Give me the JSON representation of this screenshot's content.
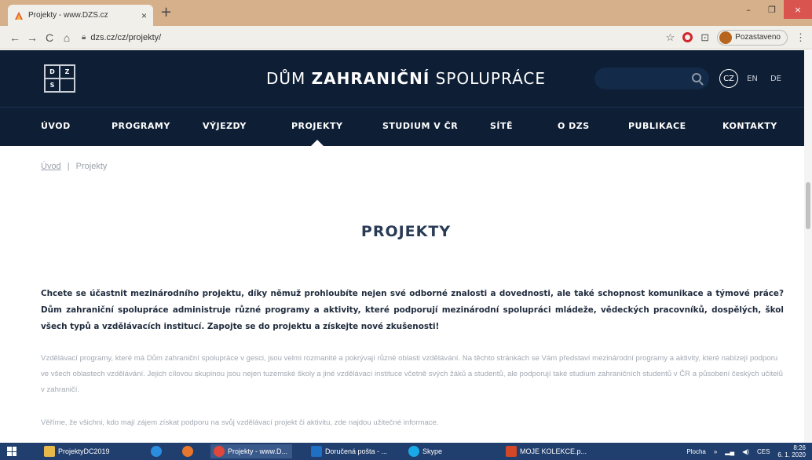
{
  "browser": {
    "tab_title": "Projekty - www.DZS.cz",
    "tab_close": "×",
    "new_tab": "+",
    "url": "dzs.cz/cz/projekty/",
    "profile_label": "Pozastaveno",
    "win_minimize": "–",
    "win_restore": "❐",
    "win_close": "×"
  },
  "site": {
    "logo": [
      "D",
      "Z",
      "S",
      ""
    ],
    "title_pre": "DŮM ",
    "title_bold": "ZAHRANIČNÍ",
    "title_post": " SPOLUPRÁCE",
    "search_placeholder": "",
    "langs": [
      "CZ",
      "EN",
      "DE"
    ],
    "active_lang": "CZ"
  },
  "nav": {
    "items": [
      "ÚVOD",
      "PROGRAMY",
      "VÝJEZDY",
      "PROJEKTY",
      "STUDIUM V ČR",
      "SÍTĚ",
      "O DZS",
      "PUBLIKACE",
      "KONTAKTY"
    ],
    "active": "PROJEKTY"
  },
  "breadcrumb": {
    "home": "Úvod",
    "separator": "|",
    "current": "Projekty"
  },
  "page": {
    "title": "PROJEKTY",
    "lead": "Chcete se účastnit mezinárodního projektu, díky němuž prohloubíte nejen své odborné znalosti a dovednosti, ale také schopnost komunikace a týmové práce? Dům zahraniční spolupráce administruje různé programy a aktivity, které podporují mezinárodní spolupráci mládeže, vědeckých pracovníků, dospělých, škol všech typů a vzdělávacích institucí. Zapojte se do projektu a získejte nové zkušenosti!",
    "p1": "Vzdělávací programy, které má Dům zahraniční spolupráce v gesci, jsou velmi rozmanité a pokrývají různé oblasti vzdělávání. Na těchto stránkách se Vám představí mezinárodní programy a aktivity, které nabízejí podporu ve všech oblastech vzdělávání. Jejich cílovou skupinou jsou nejen tuzemské školy a jiné vzdělávací instituce včetně svých žáků a studentů, ale podporují také studium zahraničních studentů v ČR a působení českých učitelů v zahraničí.",
    "p2": "Věříme, že všichni, kdo mají zájem získat podporu na svůj vzdělávací projekt či aktivitu, zde najdou užitečné informace."
  },
  "taskbar": {
    "items": [
      "ProjektyDC2019",
      "",
      "",
      "Projekty - www.D...",
      "Doručená pošta - ...",
      "Skype",
      "MOJE KOLEKCE.p..."
    ],
    "plocha": "Plocha",
    "lang": "CES",
    "time": "8:26",
    "date": "6. 1. 2020"
  },
  "colors": {
    "header_bg": "#0d1e35",
    "title_color": "#2a3b55",
    "chrome_frame": "#d6b08a"
  }
}
